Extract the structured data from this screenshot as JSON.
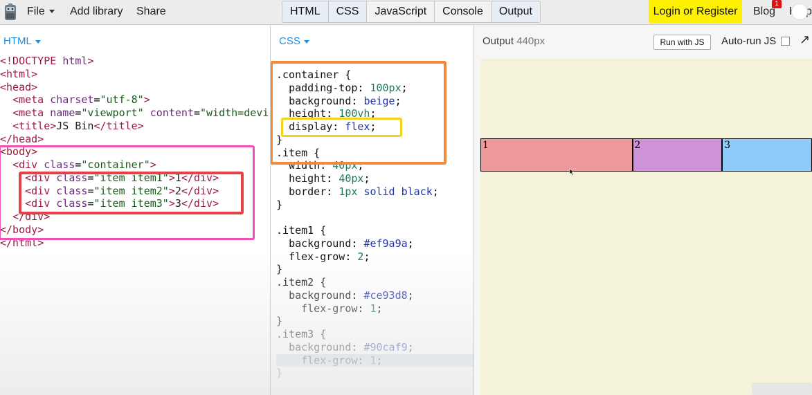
{
  "toolbar": {
    "file": "File",
    "add_library": "Add library",
    "share": "Share",
    "tabs": [
      "HTML",
      "CSS",
      "JavaScript",
      "Console",
      "Output"
    ],
    "login": "Login or Register",
    "blog": "Blog",
    "blog_badge": "1",
    "help": "Help"
  },
  "html_panel": {
    "label": "HTML",
    "lines": [
      "<!DOCTYPE html>",
      "<html>",
      "<head>",
      "  <meta charset=\"utf-8\">",
      "  <meta name=\"viewport\" content=\"width=device-width\">",
      "  <title>JS Bin</title>",
      "</head>",
      "<body>",
      "  <div class=\"container\">",
      "    <div class=\"item item1\">1</div>",
      "    <div class=\"item item2\">2</div>",
      "    <div class=\"item item3\">3</div>",
      "  </div>",
      "</body>",
      "</html>"
    ]
  },
  "css_panel": {
    "label": "CSS",
    "lines": [
      ".container {",
      "  padding-top: 100px;",
      "  background: beige;",
      "  height: 100vh;",
      "  display: flex;",
      "}",
      ".item {",
      "  width: 40px;",
      "  height: 40px;",
      "  border: 1px solid black;",
      "}",
      "",
      ".item1 {",
      "  background: #ef9a9a;",
      "  flex-grow: 2;",
      "}",
      ".item2 {",
      "  background: #ce93d8;",
      "    flex-grow: 1;",
      "}",
      ".item3 {",
      "  background: #90caf9;",
      "    flex-grow: 1;",
      "}"
    ]
  },
  "output_panel": {
    "title": "Output",
    "width_label": "440px",
    "run_button": "Run with JS",
    "autorun_label": "Auto-run JS",
    "autorun_checked": false,
    "items": [
      {
        "label": "1",
        "color": "#ef9a9a",
        "flex_grow": 2
      },
      {
        "label": "2",
        "color": "#ce93d8",
        "flex_grow": 1
      },
      {
        "label": "3",
        "color": "#90caf9",
        "flex_grow": 1
      }
    ],
    "container_color": "#f4f2d9"
  },
  "colors": {
    "accent_blue": "#1e8fe0",
    "login_yellow": "#fff200",
    "annot_pink": "#f050b8",
    "annot_red": "#e8404a",
    "annot_orange": "#f28a3a",
    "annot_yellow": "#f5d21a"
  }
}
